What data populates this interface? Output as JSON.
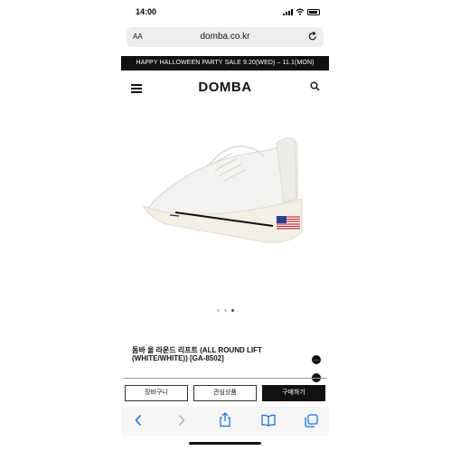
{
  "status_bar": {
    "time": "14:00"
  },
  "browser": {
    "text_size_label": "AA",
    "url": "domba.co.kr"
  },
  "banner": {
    "text": "HAPPY HALLOWEEN PARTY SALE 9.20(WED) – 11.1(MON)"
  },
  "header": {
    "logo": "DOMBA"
  },
  "carousel": {
    "total_dots": 3,
    "active_index": 2
  },
  "product": {
    "title": "돔바 올 라운드 리프트 (ALL ROUND LIFT (WHITE/WHITE)) [GA-8502]"
  },
  "actions": {
    "cart": "장바구니",
    "wishlist": "관심상품",
    "buy": "구매하기"
  },
  "colors": {
    "banner_bg": "#111111",
    "buy_bg": "#111111",
    "flag_blue": "#2a3f8f",
    "flag_red": "#c0282d"
  }
}
